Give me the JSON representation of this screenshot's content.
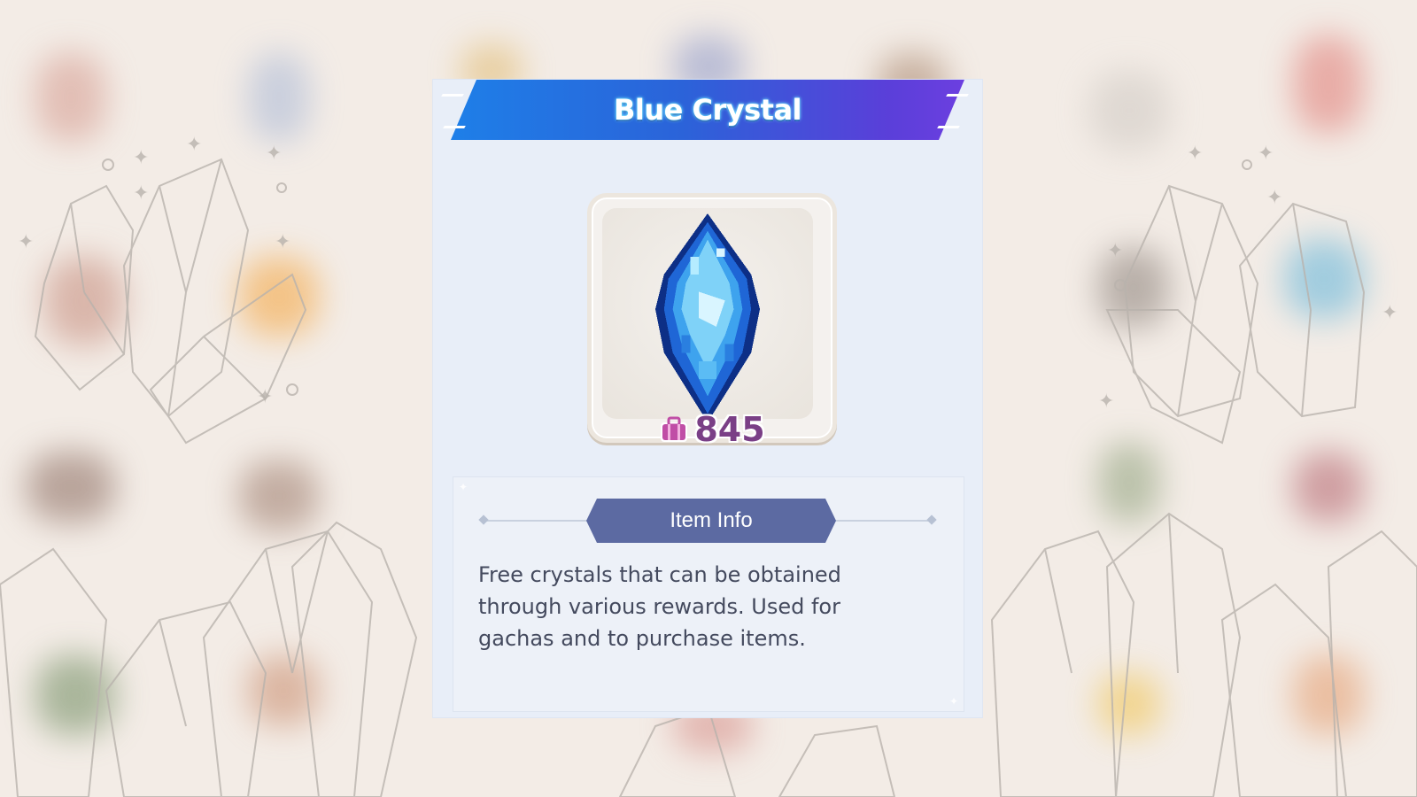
{
  "item": {
    "title": "Blue Crystal",
    "quantity": "845",
    "quantity_icon": "bag-icon",
    "image_icon": "blue-crystal-icon"
  },
  "info": {
    "tab_label": "Item Info",
    "description": "Free crystals that can be obtained through various rewards. Used for gachas and to purchase items."
  },
  "colors": {
    "banner_start": "#1e7fe8",
    "banner_end": "#6c3fe0",
    "tab": "#5c6aa2",
    "quantity": "#7a3f86",
    "background": "#f3ece6"
  }
}
